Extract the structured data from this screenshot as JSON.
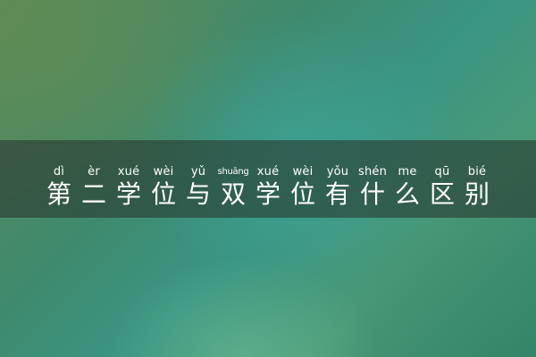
{
  "title": {
    "pinyin": [
      "dì",
      "èr",
      "xué",
      "wèi",
      "yǔ",
      "shuāng",
      "xué",
      "wèi",
      "yǒu",
      "shén",
      "me",
      "qū",
      "bié"
    ],
    "characters": [
      "第",
      "二",
      "学",
      "位",
      "与",
      "双",
      "学",
      "位",
      "有",
      "什",
      "么",
      "区",
      "别"
    ]
  },
  "colors": {
    "band": "#283a30",
    "text": "#ffffff",
    "background_primary": "#3f8a6e",
    "background_highlight": "#40aaa0"
  }
}
